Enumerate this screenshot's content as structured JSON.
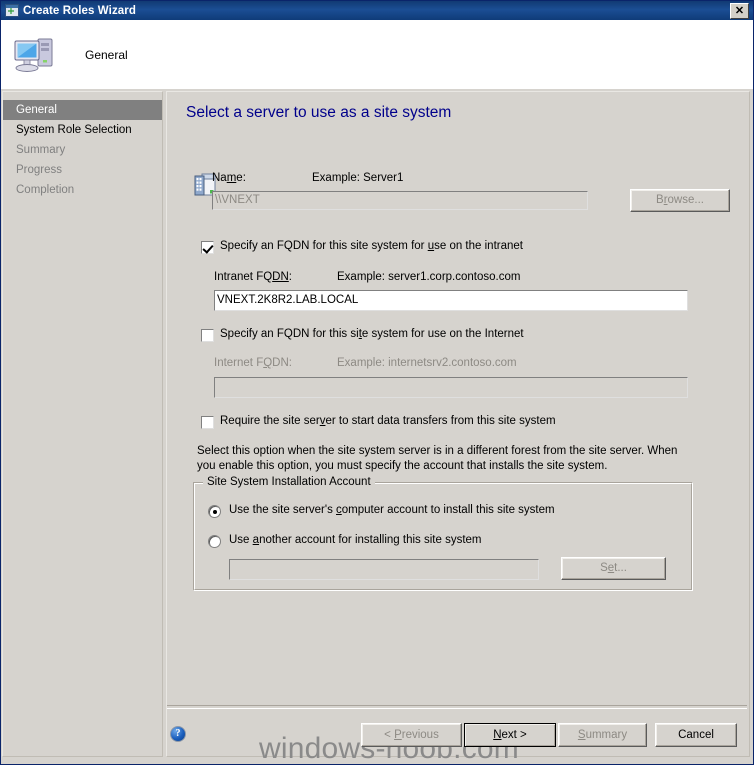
{
  "window": {
    "title": "Create Roles Wizard",
    "title_icon": "wizard-window-icon",
    "close_label": "✕"
  },
  "header": {
    "label": "General",
    "icon": "computer-icon"
  },
  "sidebar": {
    "items": [
      {
        "label": "General",
        "state": "current"
      },
      {
        "label": "System Role Selection",
        "state": "active"
      },
      {
        "label": "Summary",
        "state": "pending"
      },
      {
        "label": "Progress",
        "state": "pending"
      },
      {
        "label": "Completion",
        "state": "pending"
      }
    ]
  },
  "main": {
    "page_title": "Select a server to use as a site system",
    "server_icon": "server-icon",
    "name_section": {
      "label": "Name:",
      "label_pre": "Na",
      "label_accel": "m",
      "label_post": "e:",
      "example": "Example: Server1",
      "value": "\\\\VNEXT",
      "browse_pre": "B",
      "browse_accel": "r",
      "browse_post": "owse...",
      "browse_label": "Browse..."
    },
    "intranet": {
      "checkbox_pre": "Specify an FQDN for this site system for ",
      "checkbox_accel": "u",
      "checkbox_post": "se on the intranet",
      "checkbox_label": "Specify an FQDN for this site system for use on the intranet",
      "checked": true,
      "field_label_pre": "Intranet FQ",
      "field_label_accel": "DN",
      "field_label_post": ":",
      "field_label": "Intranet FQDN:",
      "example": "Example: server1.corp.contoso.com",
      "value": "VNEXT.2K8R2.LAB.LOCAL"
    },
    "internet": {
      "checkbox_pre": "Specify an FQDN for this si",
      "checkbox_accel": "t",
      "checkbox_post": "e system for use on the Internet",
      "checkbox_label": "Specify an FQDN for this site system for use on the Internet",
      "checked": false,
      "field_label_pre": "Internet F",
      "field_label_accel": "Q",
      "field_label_post": "DN:",
      "field_label": "Internet FQDN:",
      "example": "Example: internetsrv2.contoso.com",
      "value": ""
    },
    "require_transfer": {
      "checkbox_pre": "Require the site ser",
      "checkbox_accel": "v",
      "checkbox_post": "er to start data transfers from this site system",
      "checkbox_label": "Require the site server to start data transfers from this site system",
      "checked": false
    },
    "description": "Select this option when the site system server is in a different forest from the site server. When you enable this option, you must specify the account that installs the site system.",
    "install_account": {
      "group_title": "Site System Installation Account",
      "option1_pre": "Use the site server's ",
      "option1_accel": "c",
      "option1_post": "omputer account to install this site system",
      "option1_label": "Use the site server's computer account to install this site system",
      "option1_selected": true,
      "option2_pre": "Use ",
      "option2_accel": "a",
      "option2_post": "nother account for installing this site system",
      "option2_label": "Use another account for installing this site system",
      "option2_selected": false,
      "account_value": "",
      "set_pre": "S",
      "set_accel": "e",
      "set_post": "t...",
      "set_label": "Set..."
    }
  },
  "footer": {
    "help_icon": "help-icon",
    "help_glyph": "?",
    "previous_pre": "< ",
    "previous_accel": "P",
    "previous_post": "revious",
    "previous_label": "< Previous",
    "next_pre": "",
    "next_accel": "N",
    "next_post": "ext >",
    "next_label": "Next >",
    "summary_pre": "",
    "summary_accel": "S",
    "summary_post": "ummary",
    "summary_label": "Summary",
    "cancel_label": "Cancel",
    "watermark": "windows-noob.com"
  },
  "colors": {
    "title_bar": "#113a73",
    "face": "#d6d3ce",
    "heading": "#00008b",
    "selected_nav": "#808080",
    "disabled_text": "#8d8a84"
  }
}
